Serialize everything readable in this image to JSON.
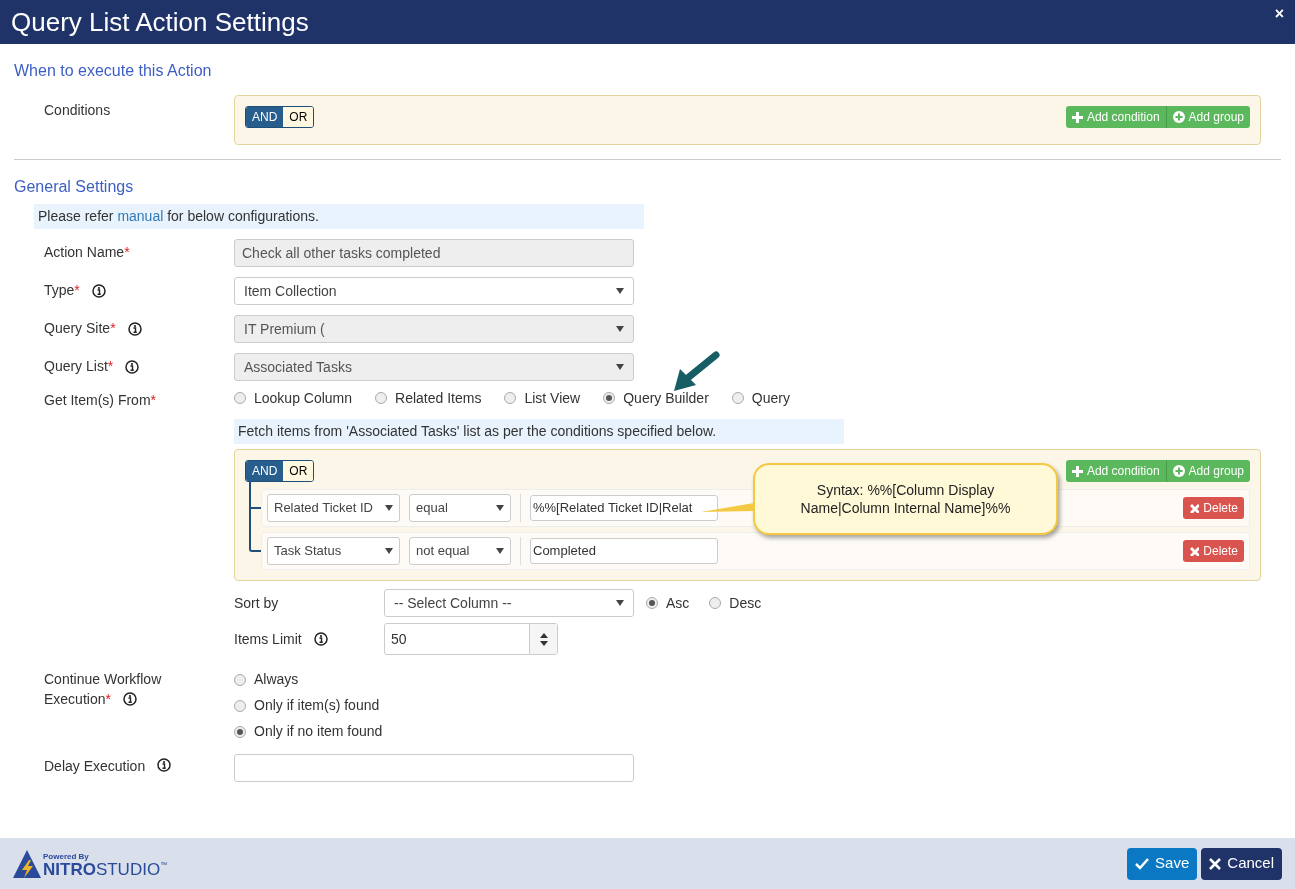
{
  "window": {
    "title": "Query List Action Settings",
    "close": "×"
  },
  "when": {
    "heading": "When to execute this Action",
    "label": "Conditions",
    "and_or": [
      {
        "label": "AND",
        "selected": true
      },
      {
        "label": "OR",
        "selected": false
      }
    ],
    "buttons": [
      "Add condition",
      "Add group"
    ]
  },
  "general": {
    "heading": "General Settings",
    "note": {
      "before": "Please refer",
      "link": "manual",
      "after": "for below configurations."
    },
    "fields": [
      {
        "kind": "text",
        "label": "Action Name",
        "mark": "*",
        "info": false,
        "value": "Check all other tasks completed",
        "disabled": true
      },
      {
        "kind": "select",
        "label": "Type",
        "mark": "*",
        "info": true,
        "value": "Item Collection",
        "disabled": false
      },
      {
        "kind": "select",
        "label": "Query Site",
        "mark": "*",
        "info": true,
        "value": "IT Premium (",
        "disabled": true
      },
      {
        "kind": "select",
        "label": "Query List",
        "mark": "*",
        "info": true,
        "value": "Associated Tasks",
        "disabled": true
      },
      {
        "kind": "radio",
        "label": "Get Item(s) From",
        "mark": "*",
        "info": false,
        "options": [
          {
            "label": "Lookup Column",
            "selected": false
          },
          {
            "label": "Related Items",
            "selected": false
          },
          {
            "label": "List View",
            "selected": false
          },
          {
            "label": "Query Builder",
            "selected": true
          },
          {
            "label": "Query",
            "selected": false
          }
        ]
      }
    ],
    "fetch_note": "Fetch items from 'Associated Tasks' list as per the conditions specified below.",
    "builder": {
      "and_or": [
        {
          "label": "AND",
          "selected": true
        },
        {
          "label": "OR",
          "selected": false
        }
      ],
      "buttons": [
        "Add condition",
        "Add group"
      ],
      "rules": [
        {
          "column": "Related Ticket ID",
          "operator": "equal",
          "value": "%%[Related Ticket ID|Relat",
          "delete": "Delete"
        },
        {
          "column": "Task Status",
          "operator": "not equal",
          "value": "Completed",
          "delete": "Delete"
        }
      ]
    },
    "callout": "Syntax: %%[Column Display Name|Column Internal Name]%%",
    "sort": {
      "label": "Sort by",
      "value": "-- Select Column --",
      "options": [
        {
          "label": "Asc",
          "selected": true
        },
        {
          "label": "Desc",
          "selected": false
        }
      ]
    },
    "items_limit": {
      "label": "Items Limit",
      "value": "50"
    },
    "continue": {
      "label_line1": "Continue Workflow",
      "label_line2": "Execution",
      "mark": "*",
      "options": [
        {
          "label": "Always",
          "selected": false
        },
        {
          "label": "Only if item(s) found",
          "selected": false
        },
        {
          "label": "Only if no item found",
          "selected": true
        }
      ]
    },
    "delay": {
      "label": "Delay Execution"
    }
  },
  "footer": {
    "powered_by": "Powered By",
    "brand_bold": "NITRO",
    "brand": "STUDIO",
    "trademark": "™",
    "buttons": [
      {
        "kind": "save",
        "label": "Save"
      },
      {
        "kind": "cancel",
        "label": "Cancel"
      }
    ]
  }
}
